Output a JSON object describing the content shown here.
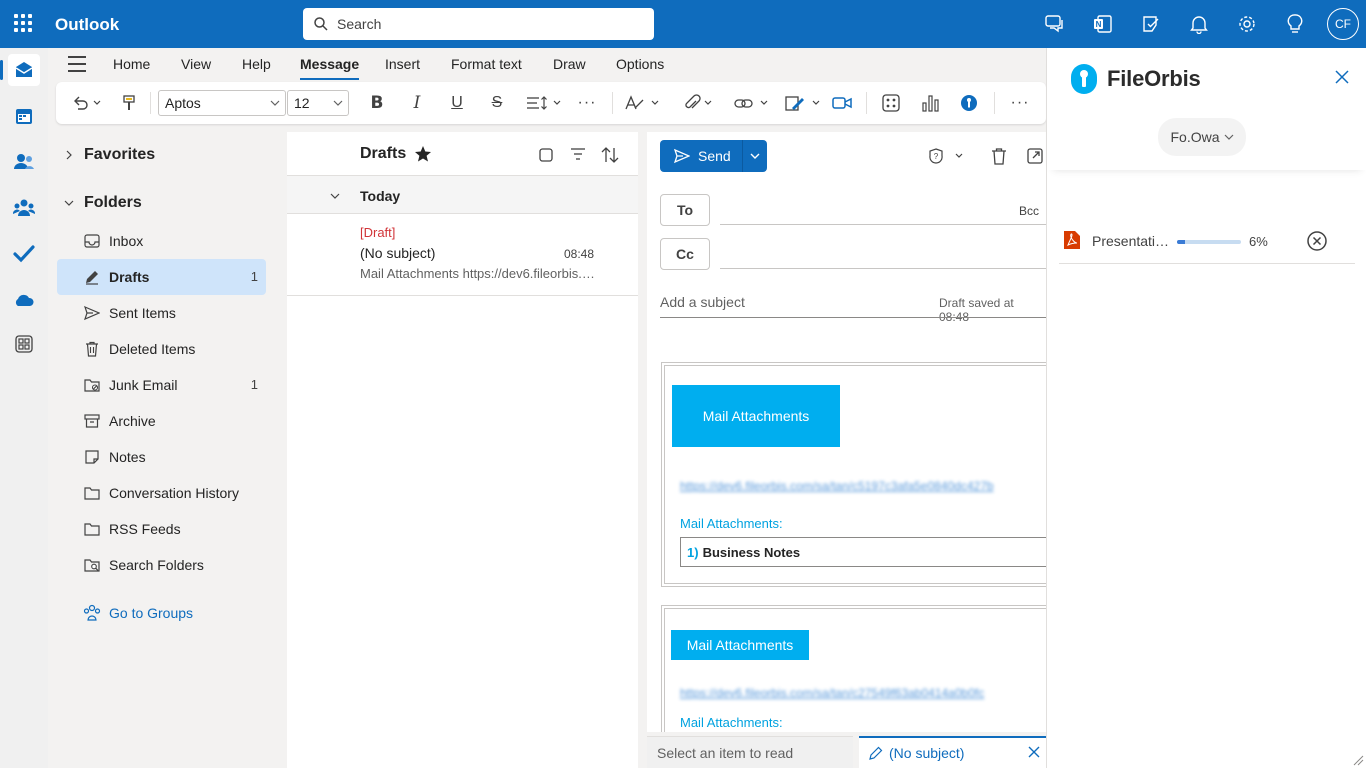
{
  "app": {
    "title": "Outlook",
    "user_initials": "CF"
  },
  "search": {
    "placeholder": "Search"
  },
  "ribbon": {
    "tabs": [
      "Home",
      "View",
      "Help",
      "Message",
      "Insert",
      "Format text",
      "Draw",
      "Options"
    ],
    "active_tab": "Message",
    "font_name": "Aptos",
    "font_size": "12"
  },
  "folders": {
    "favorites_label": "Favorites",
    "folders_label": "Folders",
    "items": [
      {
        "label": "Inbox",
        "count": "",
        "icon": "inbox-icon"
      },
      {
        "label": "Drafts",
        "count": "1",
        "icon": "drafts-icon"
      },
      {
        "label": "Sent Items",
        "count": "",
        "icon": "send-icon"
      },
      {
        "label": "Deleted Items",
        "count": "",
        "icon": "trash-icon"
      },
      {
        "label": "Junk Email",
        "count": "1",
        "icon": "junk-icon"
      },
      {
        "label": "Archive",
        "count": "",
        "icon": "archive-icon"
      },
      {
        "label": "Notes",
        "count": "",
        "icon": "note-icon"
      },
      {
        "label": "Conversation History",
        "count": "",
        "icon": "folder-icon"
      },
      {
        "label": "RSS Feeds",
        "count": "",
        "icon": "folder-icon"
      },
      {
        "label": "Search Folders",
        "count": "",
        "icon": "search-folder-icon"
      }
    ],
    "go_to_groups": "Go to Groups"
  },
  "message_list": {
    "title": "Drafts",
    "group": "Today",
    "item": {
      "tag": "[Draft]",
      "subject": "(No subject)",
      "time": "08:48",
      "preview": "Mail Attachments https://dev6.fileorbis.com/sa/tan/..."
    }
  },
  "compose": {
    "send_label": "Send",
    "to_label": "To",
    "cc_label": "Cc",
    "bcc_label": "Bcc",
    "subject_placeholder": "Add a subject",
    "draft_saved": "Draft saved at 08:48",
    "block1": {
      "button": "Mail Attachments",
      "link": "https://dev6.fileorbis.com/sa/tan/c5197c3afa5e0840dc427b",
      "label": "Mail Attachments:",
      "item_num": "1)",
      "item_name": "Business Notes"
    },
    "block2": {
      "button": "Mail Attachments",
      "link": "https://dev6.fileorbis.com/sa/tan/c27549f63ab0414a0b0fc",
      "label": "Mail Attachments:"
    }
  },
  "bottom_tabs": {
    "reading": "Select an item to read",
    "draft": "(No subject)"
  },
  "panel": {
    "brand": "FileOrbis",
    "account": "Fo.Owa",
    "upload": {
      "file_name": "Presentation.pdf",
      "progress_label": "6%",
      "progress": 0.06
    }
  },
  "colors": {
    "brand_blue": "#0f6cbd",
    "attachment_button": "#00aeef",
    "draft_tag": "#d13438"
  }
}
